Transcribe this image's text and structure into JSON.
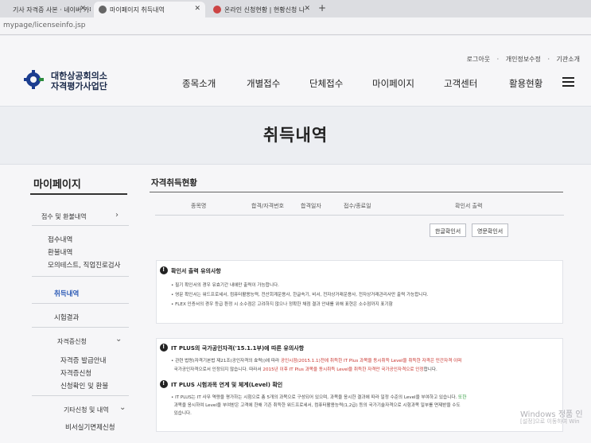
{
  "browser": {
    "tabs": [
      {
        "label": "기사 자격증 사본 · 네이버 카페",
        "active": false
      },
      {
        "label": "마이페이지 취득내역",
        "active": true
      },
      {
        "label": "온라인 신청현황 | 현황신청 나",
        "active": false
      }
    ],
    "new_tab": "+",
    "close": "✕",
    "url": "mypage/licenseinfo.jsp"
  },
  "header": {
    "util_links": [
      "로그아웃",
      "개인정보수정",
      "기관소개"
    ],
    "logo_line1": "대한상공회의소",
    "logo_line2": "자격평가사업단",
    "nav": [
      "종목소개",
      "개별접수",
      "단체접수",
      "마이페이지",
      "고객센터",
      "활용현황"
    ]
  },
  "hero": {
    "title": "취득내역"
  },
  "sidebar": {
    "title": "마이페이지",
    "group1": "접수 및 환불내역",
    "items1": [
      "접수내역",
      "환불내역",
      "모의테스트, 직업진로검사"
    ],
    "active": "취득내역",
    "item_result": "시험결과",
    "group2": "자격증신청",
    "items2": [
      "자격증 발급안내",
      "자격증신청",
      "신청확인 및 환불"
    ],
    "group3": "기타신청 및 내역",
    "items3": [
      "비서실기면제신청"
    ]
  },
  "content": {
    "title": "자격취득현황",
    "columns": [
      "종목명",
      "합격/자격번호",
      "합격일자",
      "접수/종료일",
      "확인서 출력"
    ],
    "buttons": [
      "한글확인서",
      "영문확인서"
    ],
    "notice1": {
      "heading": "확인서 출력 유의사항",
      "lines": [
        "필기 확인서의 경우 유효기간 내에만 출력이 가능합니다.",
        "영문 확인서는 워드프로세서, 컴퓨터활용능력, 전산회계운용사, 한글속기, 비서, 전자상거래운용사, 전자상거래관리사만 출력 가능합니다.",
        "FLEX 인증서의 경우 등급 환정 시 소수점은 고려하지 않으나 정확한 채점 결과 안내를 위해 표현은 소수점까지 표기함"
      ]
    },
    "notice2": {
      "heading": "IT PLUS의 국가공인자격('15.1.1부)에 따른 유의사항",
      "line1_a": "관련 법령(자격기본법 제21조(공인자격의 효력))에 따라 ",
      "line1_red": "공인시점(2015.1.1)전에 취득한 IT Plus 과목을 동시취득 Level을 취득한 자격은 민간자격 이며",
      "line2_a": "국가공인자격으로서 인정되지 않습니다. 따라서 ",
      "line2_red": "2015년 이후 IT Plus 과목을 동시취득 Level을 취득한 자격만 국가공인자격으로 인정",
      "line2_b": "합니다."
    },
    "notice3": {
      "heading": "IT PLUS 시험과목 연계 및 체계(Level) 확인",
      "line1_a": "IT PLUS는 IT 사무 역량을 평가하는 시험으로 총 5개의 과목으로 구성되어 있으며, 과목을 응시한 결과에 따라 일정 수준의 Level을 부여하고 있습니다. ",
      "line1_green": "또한",
      "line2": "과목을 응시하여 Level을 부여받은 고객에 한해 기존 취득한 워드프로세서, 컴퓨터활용능력(1,2급) 등의 국가기술자격으로 시험과목 일부를 면제받을 수도",
      "line3": "있습니다."
    }
  },
  "watermark": {
    "line1": "Windows 정품 인",
    "line2": "[설정]으로 이동하여 Win"
  }
}
